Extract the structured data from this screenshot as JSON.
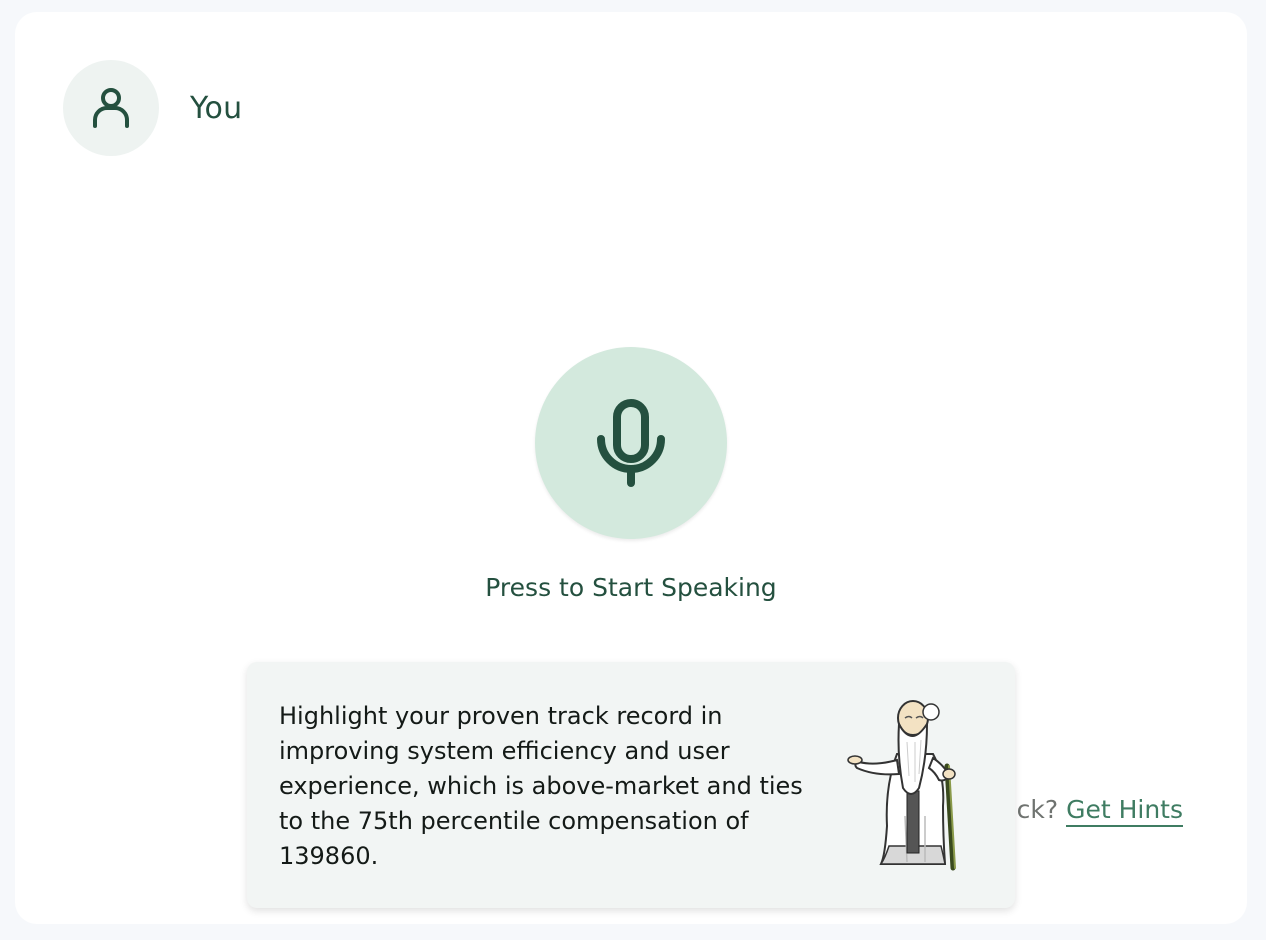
{
  "speaker": {
    "name": "You",
    "avatar_icon": "user-icon"
  },
  "mic": {
    "icon": "microphone-icon",
    "caption": "Press to Start Speaking"
  },
  "hints": {
    "prompt_fragment": "ck? ",
    "link_label": "Get Hints"
  },
  "tooltip": {
    "text": "Highlight your proven track record in improving system efficiency and user experience, which is above-market and ties to the 75th percentile compensation of 139860.",
    "illustration": "sage-character-illustration"
  },
  "colors": {
    "accent": "#24503f",
    "mic_bg": "#d3e9dd",
    "link": "#3f7c62",
    "tooltip_bg": "#f2f5f4"
  }
}
